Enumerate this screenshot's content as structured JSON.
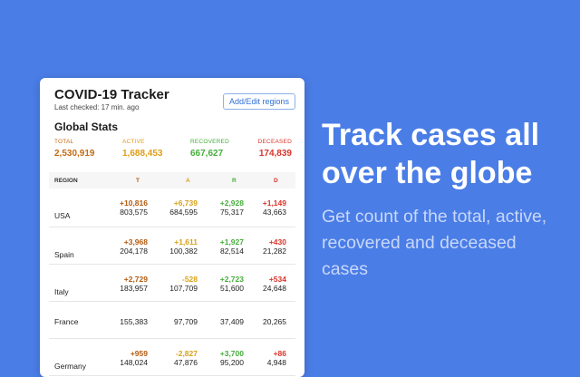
{
  "app": {
    "title": "COVID-19 Tracker",
    "last_checked": "Last checked: 17 min. ago",
    "add_button": "Add/Edit regions"
  },
  "global": {
    "heading": "Global Stats",
    "total": {
      "label": "TOTAL",
      "value": "2,530,919"
    },
    "active": {
      "label": "ACTIVE",
      "value": "1,688,453"
    },
    "recovered": {
      "label": "RECOVERED",
      "value": "667,627"
    },
    "deceased": {
      "label": "DECEASED",
      "value": "174,839"
    }
  },
  "table": {
    "headers": {
      "region": "REGION",
      "t": "T",
      "a": "A",
      "r": "R",
      "d": "D"
    },
    "rows": [
      {
        "region": "USA",
        "t_delta": "+10,816",
        "t": "803,575",
        "a_delta": "+6,739",
        "a": "684,595",
        "r_delta": "+2,928",
        "r": "75,317",
        "d_delta": "+1,149",
        "d": "43,663"
      },
      {
        "region": "Spain",
        "t_delta": "+3,968",
        "t": "204,178",
        "a_delta": "+1,611",
        "a": "100,382",
        "r_delta": "+1,927",
        "r": "82,514",
        "d_delta": "+430",
        "d": "21,282"
      },
      {
        "region": "Italy",
        "t_delta": "+2,729",
        "t": "183,957",
        "a_delta": "-528",
        "a": "107,709",
        "r_delta": "+2,723",
        "r": "51,600",
        "d_delta": "+534",
        "d": "24,648"
      },
      {
        "region": "France",
        "t_delta": "",
        "t": "155,383",
        "a_delta": "",
        "a": "97,709",
        "r_delta": "",
        "r": "37,409",
        "d_delta": "",
        "d": "20,265"
      },
      {
        "region": "Germany",
        "t_delta": "+959",
        "t": "148,024",
        "a_delta": "-2,827",
        "a": "47,876",
        "r_delta": "+3,700",
        "r": "95,200",
        "d_delta": "+86",
        "d": "4,948"
      }
    ]
  },
  "promo": {
    "headline": "Track cases all over the globe",
    "description": "Get count of the total, active, recovered and deceased cases"
  },
  "colors": {
    "background": "#4a7de6",
    "total": "#c56a12",
    "active": "#e09d16",
    "recovered": "#46ad3c",
    "deceased": "#d9352a"
  }
}
